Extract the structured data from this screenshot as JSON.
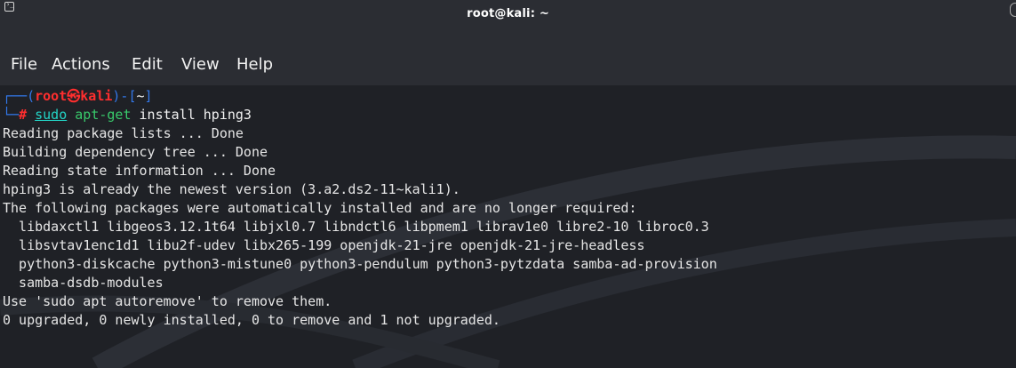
{
  "window": {
    "title": "root@kali: ~"
  },
  "icons": {
    "app": "terminal-icon",
    "right_edge": "window-control-icon"
  },
  "menu": {
    "items": [
      "File",
      "Actions",
      "Edit",
      "View",
      "Help"
    ]
  },
  "prompt": {
    "line1_left": "┌──(",
    "user": "root",
    "separator": "㉿",
    "host": "kali",
    "bracket_close": ")-[",
    "path": "~",
    "bracket_end": "]",
    "line2_left": "└─",
    "hash": "#",
    "cmd_sudo": "sudo",
    "cmd_bin": "apt-get",
    "cmd_args": "install hping3"
  },
  "output": [
    "Reading package lists ... Done",
    "Building dependency tree ... Done",
    "Reading state information ... Done",
    "hping3 is already the newest version (3.a2.ds2-11~kali1).",
    "The following packages were automatically installed and are no longer required:",
    "  libdaxctl1 libgeos3.12.1t64 libjxl0.7 libndctl6 libpmem1 librav1e0 libre2-10 libroc0.3",
    "  libsvtav1enc1d1 libu2f-udev libx265-199 openjdk-21-jre openjdk-21-jre-headless",
    "  python3-diskcache python3-mistune0 python3-pendulum python3-pytzdata samba-ad-provision",
    "  samba-dsdb-modules",
    "Use 'sudo apt autoremove' to remove them.",
    "0 upgraded, 0 newly installed, 0 to remove and 1 not upgraded."
  ],
  "colors": {
    "background": "#1f2126",
    "titlebar": "#2b2d33",
    "prompt_blue": "#3277e9",
    "prompt_red": "#ff2e2e",
    "command_green": "#38c96b",
    "sudo_cyan": "#23d4c6",
    "text": "#e6e6e6"
  }
}
